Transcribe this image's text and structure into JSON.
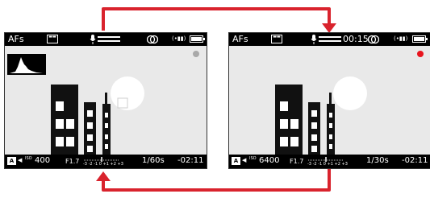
{
  "colors": {
    "accent_red": "#d9232d",
    "sky": "#e9e9e9",
    "bar": "#000000",
    "building": "#111111"
  },
  "left_screen": {
    "af_mode": "AFs",
    "iso_value": "400",
    "aperture": "F1.7",
    "shutter": "1/60s",
    "remaining": "-02:11",
    "record_dot_color": "#a9a9a9",
    "shows_histogram": true
  },
  "right_screen": {
    "af_mode": "AFs",
    "record_time": "00:15",
    "iso_value": "6400",
    "aperture": "F1.7",
    "shutter": "1/30s",
    "remaining": "-02:11",
    "record_dot_color": "#e8141e"
  },
  "ev_scale_labels": [
    "-3",
    "-2",
    "-1",
    "0",
    "+1",
    "+2",
    "+3"
  ],
  "icons": [
    "video-format-icon",
    "microphone-icon",
    "audio-level-meter-icon",
    "stabilization-rings-icon",
    "wireless-signal-icon",
    "battery-icon",
    "af-icon",
    "histogram-icon"
  ]
}
